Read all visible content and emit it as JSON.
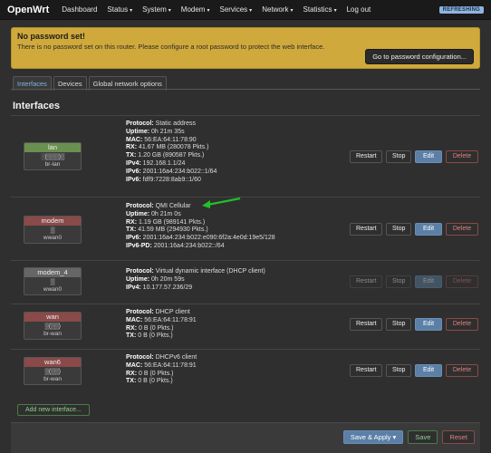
{
  "nav": {
    "brand": "OpenWrt",
    "items": [
      {
        "label": "Dashboard",
        "caret": false
      },
      {
        "label": "Status",
        "caret": true
      },
      {
        "label": "System",
        "caret": true
      },
      {
        "label": "Modem",
        "caret": true
      },
      {
        "label": "Services",
        "caret": true
      },
      {
        "label": "Network",
        "caret": true
      },
      {
        "label": "Statistics",
        "caret": true
      },
      {
        "label": "Log out",
        "caret": false
      }
    ],
    "badge": "REFRESHING"
  },
  "alert": {
    "title": "No password set!",
    "text": "There is no password set on this router. Please configure a root password to protect the web interface.",
    "button": "Go to password configuration..."
  },
  "tabs": [
    "Interfaces",
    "Devices",
    "Global network options"
  ],
  "section_title": "Interfaces",
  "interfaces": [
    {
      "name": "lan",
      "color": "#6a8f4f",
      "icons": "░(▒▒▒)▒",
      "device": "br-lan",
      "lines": [
        {
          "k": "Protocol:",
          "v": " Static address"
        },
        {
          "k": "Uptime:",
          "v": " 0h 21m 35s"
        },
        {
          "k": "MAC:",
          "v": " 56:EA:64:11:78:90"
        },
        {
          "k": "RX:",
          "v": " 41.67 MB (280078 Pkts.)"
        },
        {
          "k": "TX:",
          "v": " 1.20 GB (890587 Pkts.)"
        },
        {
          "k": "IPv4:",
          "v": " 192.168.1.1/24"
        },
        {
          "k": "IPv6:",
          "v": " 2001:16a4:234:b022::1/64"
        },
        {
          "k": "IPv6:",
          "v": " fdf9:7228:8ab9::1/60"
        }
      ],
      "buttons": {
        "restart": "Restart",
        "stop": "Stop",
        "edit": "Edit",
        "delete": "Delete"
      },
      "disabled": false
    },
    {
      "name": "modem",
      "color": "#8a4a4a",
      "icons": "▒",
      "device": "wwan0",
      "lines": [
        {
          "k": "Protocol:",
          "v": " QMI Cellular"
        },
        {
          "k": "Uptime:",
          "v": " 0h 21m 0s"
        },
        {
          "k": "RX:",
          "v": " 1.19 GB (989141 Pkts.)"
        },
        {
          "k": "TX:",
          "v": " 41.59 MB (294930 Pkts.)"
        },
        {
          "k": "IPv6:",
          "v": " 2001:16a4:234:b022:e090:6f2a:4e0d:19e5/128"
        },
        {
          "k": "IPv6-PD:",
          "v": " 2001:16a4:234:b022::/64"
        }
      ],
      "buttons": {
        "restart": "Restart",
        "stop": "Stop",
        "edit": "Edit",
        "delete": "Delete"
      },
      "disabled": false
    },
    {
      "name": "modem_4",
      "color": "#666666",
      "icons": "▒",
      "device": "wwan0",
      "lines": [
        {
          "k": "Protocol:",
          "v": " Virtual dynamic interface (DHCP client)"
        },
        {
          "k": "Uptime:",
          "v": " 0h 20m 59s"
        },
        {
          "k": "IPv4:",
          "v": " 10.177.57.236/29"
        }
      ],
      "buttons": {
        "restart": "Restart",
        "stop": "Stop",
        "edit": "Edit",
        "delete": "Delete"
      },
      "disabled": true
    },
    {
      "name": "wan",
      "color": "#8a4a4a",
      "icons": "▒(▒▒)",
      "device": "br-wan",
      "lines": [
        {
          "k": "Protocol:",
          "v": " DHCP client"
        },
        {
          "k": "MAC:",
          "v": " 56:EA:64:11:78:91"
        },
        {
          "k": "RX:",
          "v": " 0 B (0 Pkts.)"
        },
        {
          "k": "TX:",
          "v": " 0 B (0 Pkts.)"
        }
      ],
      "buttons": {
        "restart": "Restart",
        "stop": "Stop",
        "edit": "Edit",
        "delete": "Delete"
      },
      "disabled": false
    },
    {
      "name": "wan6",
      "color": "#8a4a4a",
      "icons": "▒(▒▒)",
      "device": "br-wan",
      "lines": [
        {
          "k": "Protocol:",
          "v": " DHCPv6 client"
        },
        {
          "k": "MAC:",
          "v": " 56:EA:64:11:78:91"
        },
        {
          "k": "RX:",
          "v": " 0 B (0 Pkts.)"
        },
        {
          "k": "TX:",
          "v": " 0 B (0 Pkts.)"
        }
      ],
      "buttons": {
        "restart": "Restart",
        "stop": "Stop",
        "edit": "Edit",
        "delete": "Delete"
      },
      "disabled": false
    }
  ],
  "add_button": "Add new interface...",
  "footer": {
    "apply": "Save & Apply",
    "save": "Save",
    "reset": "Reset"
  },
  "colors": {
    "accent": "#5b7fa6",
    "alert": "#cfa93b",
    "annotation_arrow": "#22c02a"
  }
}
